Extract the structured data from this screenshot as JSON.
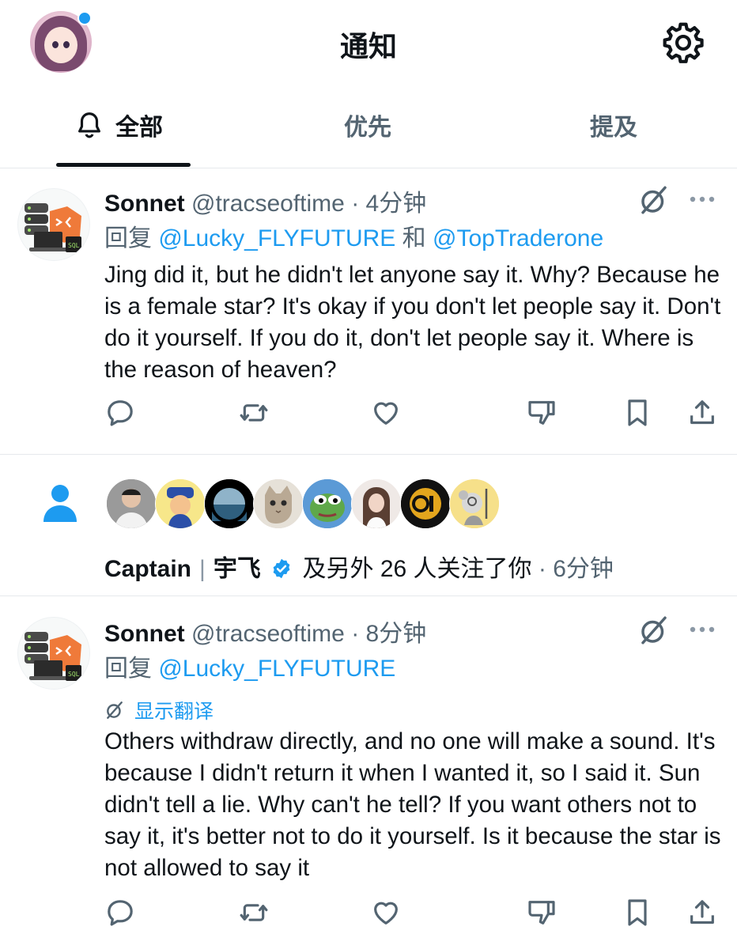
{
  "header": {
    "title": "通知",
    "settings_icon": "gear-icon"
  },
  "tabs": [
    {
      "label": "全部",
      "icon": "bell-icon",
      "active": true
    },
    {
      "label": "优先",
      "active": false
    },
    {
      "label": "提及",
      "active": false
    }
  ],
  "notifications": [
    {
      "type": "reply",
      "name": "Sonnet",
      "handle": "@tracseoftime",
      "time": "· 4分钟",
      "reply_prefix": "回复",
      "reply_to": [
        "@Lucky_FLYFUTURE",
        "@TopTraderone"
      ],
      "reply_joiner": "和",
      "text": "Jing did it, but he didn't let anyone say it. Why? Because he is a female star? It's okay if you don't let people say it. Don't do it yourself. If you do it, don't let people say it. Where is the reason of heaven?"
    },
    {
      "type": "follow",
      "name": "Captain",
      "name2": "宇飞",
      "verified": true,
      "text": "及另外 26 人关注了你",
      "time": "· 6分钟",
      "avatar_count": 8
    },
    {
      "type": "reply",
      "name": "Sonnet",
      "handle": "@tracseoftime",
      "time": "· 8分钟",
      "reply_prefix": "回复",
      "reply_to": [
        "@Lucky_FLYFUTURE"
      ],
      "translate_label": "显示翻译",
      "text": "Others withdraw directly, and no one will make a sound. It's because I didn't return it when I wanted it, so I said it. Sun didn't tell a lie. Why can't he tell? If you want others not to say it, it's better not to do it yourself. Is it because the star is not allowed to say it"
    }
  ],
  "colors": {
    "accent": "#1d9bf0",
    "text": "#0f1419",
    "muted": "#536471",
    "divider": "#e6e9ec"
  }
}
